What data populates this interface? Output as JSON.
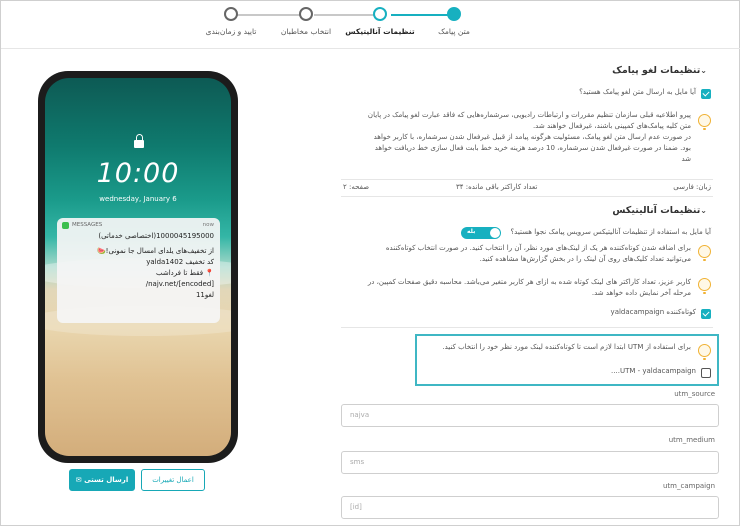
{
  "stepper": {
    "steps": [
      {
        "label": "متن پیامک",
        "state": "done"
      },
      {
        "label": "تنظیمات آنالیتیکس",
        "state": "active"
      },
      {
        "label": "انتخاب مخاطبان",
        "state": "pending"
      },
      {
        "label": "تایید و زمان‌بندی",
        "state": "pending"
      }
    ]
  },
  "optout": {
    "title": "تنظیمات لغو پیامک",
    "checkbox_label": "آیا مایل به ارسال متن لغو پیامک هستید؟",
    "checked": true,
    "info": [
      "پیرو اطلاعیه قبلی سازمان تنظیم مقررات و ارتباطات رادیویی، سرشماره‌هایی که فاقد عبارت لغو پیامک در پایان",
      "متن کلیه پیامک‌های کمپینی باشند، غیرفعال خواهند شد.",
      "در صورت عدم ارسال متن لغو پیامک، مسئولیت هرگونه پیامد از قبیل غیرفعال شدن سرشماره، با کاربر خواهد",
      "بود. ضمنا در صورت غیرفعال شدن سرشماره، 10 درصد هزینه خرید خط بابت فعال سازی خط دریافت خواهد",
      "شد"
    ],
    "stats": {
      "language": "زبان: فارسی",
      "remaining": "تعداد کاراکتر باقی مانده: ۳۴",
      "page": "صفحه: ۲"
    }
  },
  "analytics": {
    "title": "تنظیمات آنالیتیکس",
    "question": "آیا مایل به استفاده از تنظیمات آنالیتیکس سرویس پیامک نجوا هستید؟",
    "toggle_label": "بله",
    "info1": [
      "برای اضافه شدن کوتاه‌کننده هر یک از لینک‌های مورد نظر، آن را انتخاب کنید. در صورت انتخاب کوتاه‌کننده",
      "می‌توانید تعداد کلیک‌های روی آن لینک را در بخش گزارش‌ها مشاهده کنید."
    ],
    "info2": [
      "کاربر عزیز، تعداد کاراکتر های لینک کوتاه شده به ازای هر کاربر متغیر می‌باشد. محاسبه دقیق صفحات کمپین، در",
      "مرحله آخر نمایش داده خواهد شد."
    ],
    "shortener_label": "کوتاه‌کننده yaldacampaign",
    "shortener_checked": true,
    "utm_info": "برای استفاده از UTM ابتدا لازم است تا کوتاه‌کننده لینک مورد نظر خود را انتخاب کنید.",
    "utm_checkbox_label": "UTM - yaldacampaign....",
    "utm_checked": false,
    "fields": [
      {
        "label": "utm_source",
        "value": "najva"
      },
      {
        "label": "utm_medium",
        "value": "sms"
      },
      {
        "label": "utm_campaign",
        "value": "[id]"
      }
    ]
  },
  "phone": {
    "time": "10:00",
    "date": "wednesday, January 6",
    "notification": {
      "app": "MESSAGES",
      "when": "now",
      "lines": [
        "1000045195000(اختصاصی خدماتی)",
        "از تخفیف‌های یلدای امسال جا نمونی!🍉",
        "کد تخفیف yalda1402",
        "📍 فقط تا فرداشب",
        "najv.net/[encoded]/",
        "لغو11"
      ]
    }
  },
  "buttons": {
    "send_test": "ارسال تستی",
    "apply_changes": "اعمال تغییرات"
  },
  "colors": {
    "accent": "#17b0c0",
    "bulb": "#f0b234"
  }
}
